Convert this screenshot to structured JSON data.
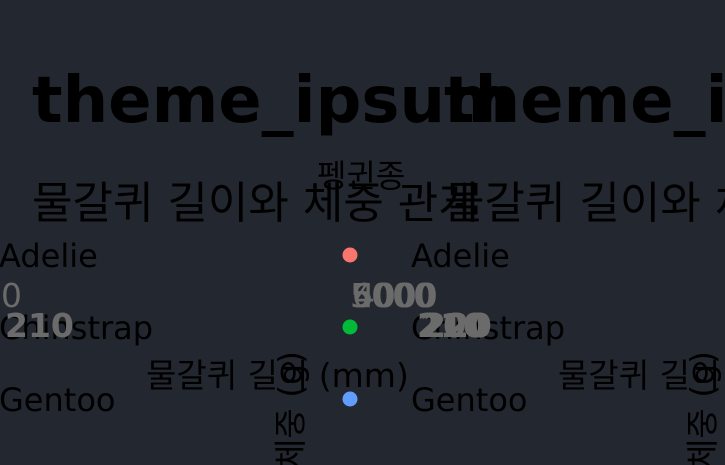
{
  "background": "#23272f",
  "chart_data": [
    {
      "type": "scatter",
      "title": "theme_ipsum",
      "subtitle": "물갈퀴 길이와 체중 관계",
      "xlabel": "물갈퀴 길이 (mm)",
      "ylabel": "체중 (g)",
      "legend_title": "펭귄종",
      "legend_position": "right",
      "x_ticks": [
        "210"
      ],
      "y_ticks": [
        "6000"
      ],
      "series": [
        {
          "name": "Adelie",
          "color": "#f8766d",
          "values": []
        },
        {
          "name": "Chinstrap",
          "color": "#00ba38",
          "values": []
        },
        {
          "name": "Gentoo",
          "color": "#619cff",
          "values": []
        }
      ]
    },
    {
      "type": "scatter",
      "title": "theme_ipsum_rc",
      "subtitle": "물갈퀴 길이와 체중 관계",
      "xlabel": "물갈퀴 길이 (mm)",
      "ylabel": "체중 (g)",
      "legend_title": "펭귄종",
      "legend_position": "right",
      "x_ticks": [
        "210",
        "200",
        "220"
      ],
      "y_ticks": [
        "5000",
        "6000",
        "4000"
      ],
      "series": [
        {
          "name": "Adelie",
          "color": "#f8766d",
          "values": []
        },
        {
          "name": "Chinstrap",
          "color": "#00ba38",
          "values": []
        },
        {
          "name": "Gentoo",
          "color": "#619cff",
          "values": []
        }
      ]
    }
  ]
}
